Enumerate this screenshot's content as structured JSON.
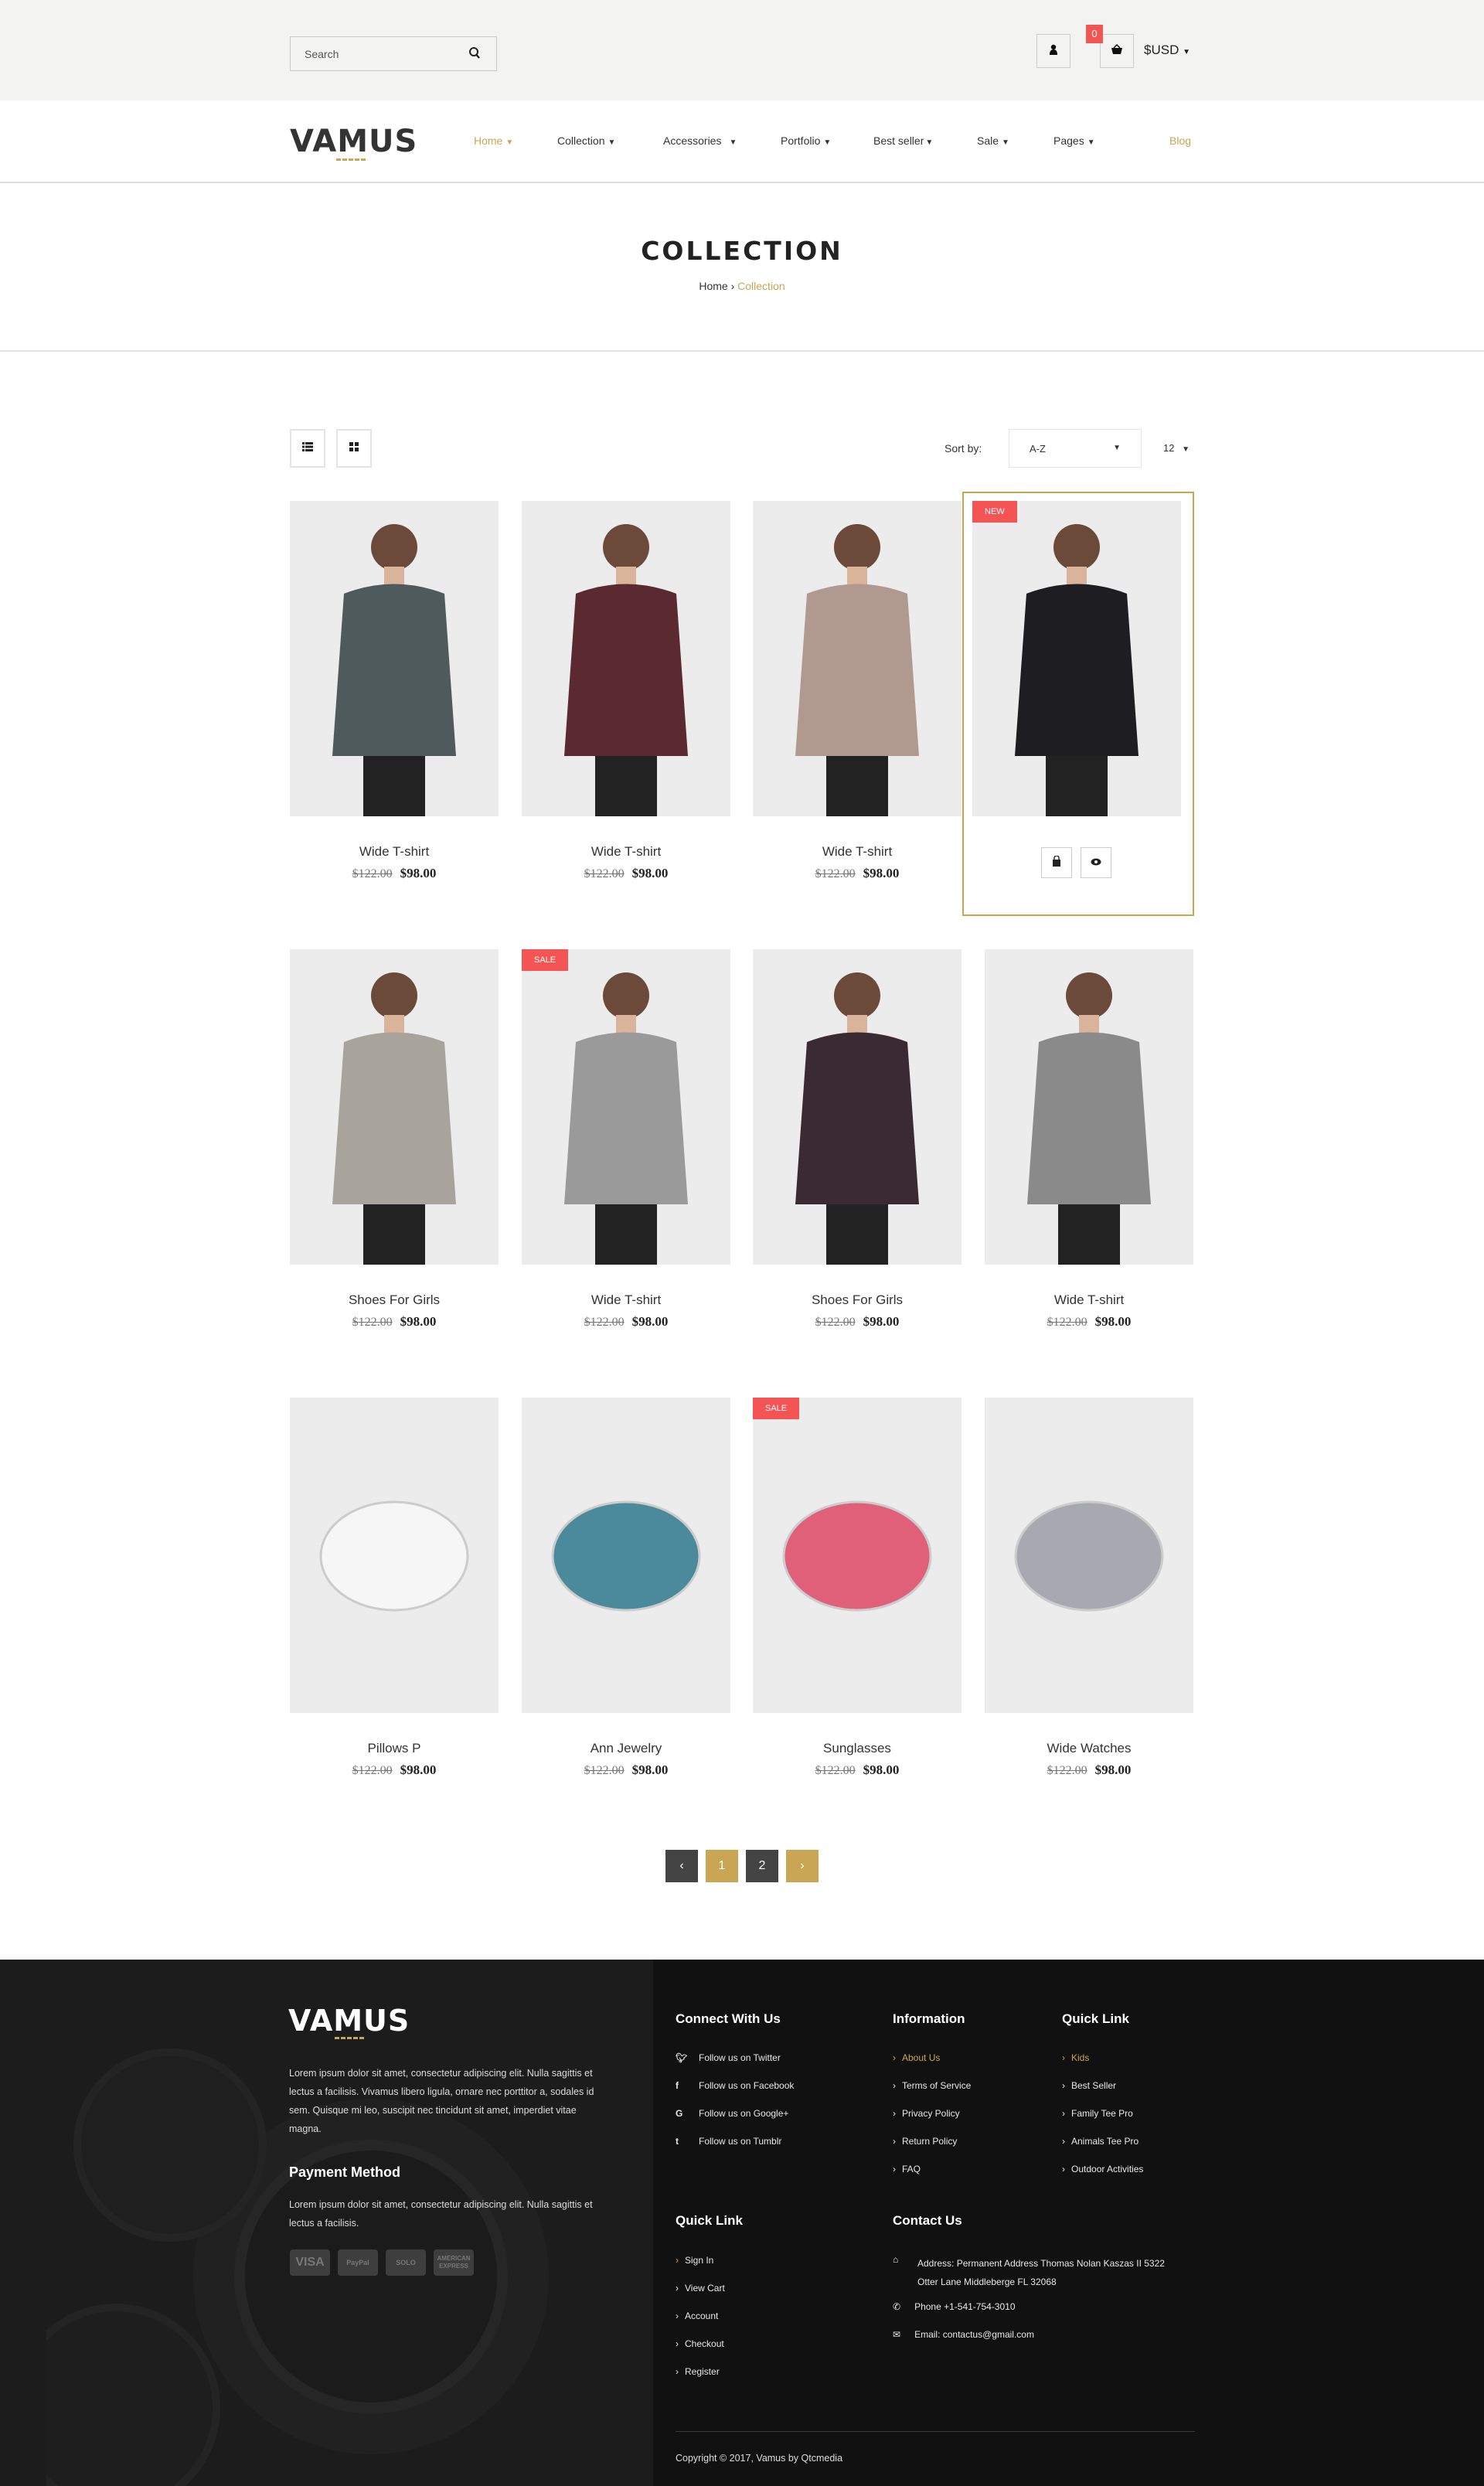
{
  "colors": {
    "accent": "#c9a654",
    "badge": "#f45454",
    "footer": "#111111",
    "pager_dark": "#444444"
  },
  "topbar": {
    "search_placeholder": "Search",
    "cart_count": "0",
    "currency": "$USD",
    "icons": [
      "search-icon",
      "user-icon",
      "basket-icon"
    ]
  },
  "nav": {
    "logo": "VAMUS",
    "items": [
      {
        "label": "Home",
        "active": true
      },
      {
        "label": "Collection"
      },
      {
        "label": "Accessories"
      },
      {
        "label": "Portfolio"
      },
      {
        "label": "Best seller"
      },
      {
        "label": "Sale"
      },
      {
        "label": "Pages"
      }
    ],
    "blog": "Blog"
  },
  "page": {
    "title": "COLLECTION",
    "breadcrumb": [
      "Home",
      "Collection"
    ]
  },
  "toolbar": {
    "sort_label": "Sort by:",
    "sort_value": "A-Z",
    "per_page": "12"
  },
  "products": [
    {
      "name": "Wide T-shirt",
      "old": "$122.00",
      "price": "$98.00",
      "badge": "",
      "color": "#4e5a5c"
    },
    {
      "name": "Wide T-shirt",
      "old": "$122.00",
      "price": "$98.00",
      "badge": "",
      "color": "#5a2a30"
    },
    {
      "name": "Wide T-shirt",
      "old": "$122.00",
      "price": "$98.00",
      "badge": "",
      "color": "#b09a90"
    },
    {
      "name": "",
      "old": "",
      "price": "",
      "badge": "NEW",
      "color": "#1e1e22"
    },
    {
      "name": "Shoes For Girls",
      "old": "$122.00",
      "price": "$98.00",
      "badge": "",
      "color": "#a8a49c"
    },
    {
      "name": "Wide T-shirt",
      "old": "$122.00",
      "price": "$98.00",
      "badge": "SALE",
      "color": "#9a9a9a"
    },
    {
      "name": "Shoes For Girls",
      "old": "$122.00",
      "price": "$98.00",
      "badge": "",
      "color": "#3a2a32"
    },
    {
      "name": "Wide T-shirt",
      "old": "$122.00",
      "price": "$98.00",
      "badge": "",
      "color": "#8a8a8a"
    },
    {
      "name": "Pillows P",
      "old": "$122.00",
      "price": "$98.00",
      "badge": "",
      "color": "#f6f6f6"
    },
    {
      "name": "Ann Jewelry",
      "old": "$122.00",
      "price": "$98.00",
      "badge": "",
      "color": "#4a8a9a"
    },
    {
      "name": "Sunglasses",
      "old": "$122.00",
      "price": "$98.00",
      "badge": "SALE",
      "color": "#e0607a"
    },
    {
      "name": "Wide Watches",
      "old": "$122.00",
      "price": "$98.00",
      "badge": "",
      "color": "#a8a8b0"
    }
  ],
  "pagination": {
    "prev": "‹",
    "pages": [
      "1",
      "2"
    ],
    "current": "1",
    "next": "›"
  },
  "footer": {
    "logo": "VAMUS",
    "about": "Lorem ipsum dolor sit amet, consectetur adipiscing elit. Nulla sagittis et lectus a facilisis. Vivamus libero ligula, ornare nec porttitor a, sodales id sem. Quisque mi leo, suscipit nec tincidunt sit amet, imperdiet vitae magna.",
    "payment_title": "Payment Method",
    "payment_text": "Lorem ipsum dolor sit amet, consectetur adipiscing elit. Nulla sagittis et lectus a facilisis.",
    "payment_cards": [
      "VISA",
      "PayPal",
      "SOLO",
      "AMERICAN EXPRESS"
    ],
    "connect_title": "Connect With Us",
    "connect": [
      {
        "icon": "twitter-icon",
        "label": "Follow us on Twitter"
      },
      {
        "icon": "facebook-icon",
        "label": "Follow us on Facebook"
      },
      {
        "icon": "google-icon",
        "label": "Follow us on Google+"
      },
      {
        "icon": "tumblr-icon",
        "label": "Follow us on Tumblr"
      }
    ],
    "info_title": "Information",
    "info": [
      "About Us",
      "Terms of Service",
      "Privacy Policy",
      "Return Policy",
      "FAQ"
    ],
    "quick1_title": "Quick Link",
    "quick1": [
      "Kids",
      "Best Seller",
      "Family Tee Pro",
      "Animals Tee Pro",
      "Outdoor Activities"
    ],
    "quick2_title": "Quick Link",
    "quick2": [
      "Sign In",
      "View Cart",
      "Account",
      "Checkout",
      "Register"
    ],
    "contact_title": "Contact Us",
    "address": "Address: Permanent Address Thomas Nolan Kaszas II 5322 Otter Lane Middleberge FL 32068",
    "phone": "Phone +1-541-754-3010",
    "email": "Email: contactus@gmail.com",
    "copyright": "Copyright © 2017, Vamus by Qtcmedia"
  }
}
